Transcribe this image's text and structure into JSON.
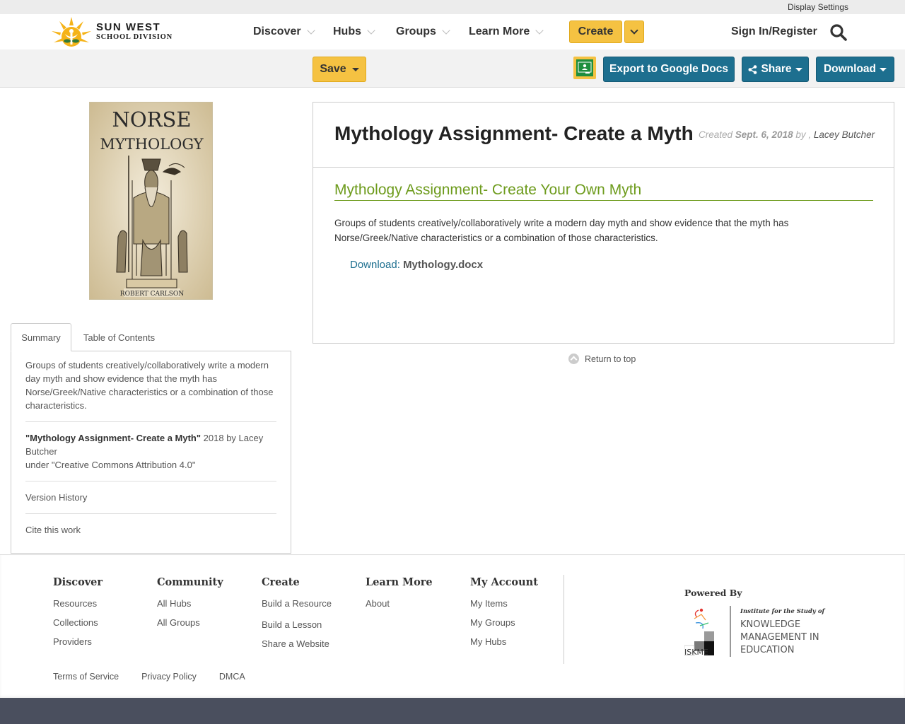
{
  "utility_bar": {
    "display_settings": "Display Settings"
  },
  "header": {
    "logo": {
      "line1": "SUN WEST",
      "line2": "SCHOOL DIVISION"
    },
    "nav": [
      {
        "label": "Discover"
      },
      {
        "label": "Hubs"
      },
      {
        "label": "Groups"
      },
      {
        "label": "Learn More"
      }
    ],
    "create_label": "Create",
    "signin_label": "Sign In/Register"
  },
  "toolbar": {
    "save_label": "Save",
    "export_label": "Export to Google Docs",
    "share_label": "Share",
    "download_label": "Download"
  },
  "cover": {
    "title_line1": "NORSE",
    "title_line2": "MYTHOLOGY",
    "author": "ROBERT CARLSON"
  },
  "tabs": {
    "summary": "Summary",
    "toc": "Table of Contents"
  },
  "summary_panel": {
    "description": "Groups of students creatively/collaboratively write a modern day myth and show evidence that the myth has Norse/Greek/Native characteristics or a combination of those characteristics.",
    "attribution_title": "\"Mythology Assignment- Create a Myth\"",
    "attribution_rest": " 2018 by Lacey Butcher",
    "license_line": "under \"Creative Commons Attribution 4.0\"",
    "version_history": "Version History",
    "cite": "Cite this work"
  },
  "resource": {
    "title": "Mythology Assignment- Create a Myth",
    "created_prefix": "Created ",
    "created_date": "Sept. 6, 2018",
    "by_text": " by , ",
    "author": "Lacey Butcher",
    "section_title": "Mythology Assignment- Create Your Own Myth",
    "description": "Groups of students creatively/collaboratively write a modern day myth and show evidence that the myth has Norse/Greek/Native characteristics or a combination of those characteristics.",
    "download_label": "Download:",
    "download_file": "Mythology.docx"
  },
  "return_to_top": "Return to top",
  "footer": {
    "columns": [
      {
        "heading": "Discover",
        "links": [
          "Resources",
          "Collections",
          "Providers"
        ]
      },
      {
        "heading": "Community",
        "links": [
          "All Hubs",
          "All Groups"
        ]
      },
      {
        "heading": "Create",
        "links": [
          "Build a Resource",
          "Build a Lesson",
          "Share a Website"
        ]
      },
      {
        "heading": "Learn More",
        "links": [
          "About"
        ]
      },
      {
        "heading": "My Account",
        "links": [
          "My Items",
          "My Groups",
          "My Hubs"
        ]
      }
    ],
    "powered_by": "Powered By",
    "iskme": {
      "institute": "Institute for the Study of",
      "line1": "KNOWLEDGE",
      "line2": "MANAGEMENT IN",
      "line3": "EDUCATION",
      "acronym": "ISKME"
    },
    "legal": [
      "Terms of Service",
      "Privacy Policy",
      "DMCA"
    ]
  },
  "colors": {
    "accent_yellow": "#f5c242",
    "teal": "#1d6f8f",
    "green_heading": "#6d9b1c",
    "footer_bar": "#4a4f5e"
  },
  "icons": [
    "chevron-down-icon",
    "search-icon",
    "caret-down-icon",
    "google-classroom-icon",
    "share-icon",
    "arrow-up-circle-icon",
    "sun-logo-icon"
  ]
}
